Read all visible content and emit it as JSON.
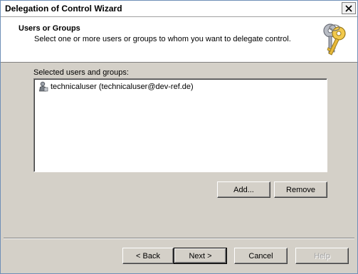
{
  "window": {
    "title": "Delegation of Control Wizard",
    "close_glyph": "✕"
  },
  "header": {
    "title": "Users or Groups",
    "subtitle": "Select one or more users or groups to whom you want to delegate control.",
    "icon": "keys-icon"
  },
  "selection": {
    "label": "Selected users and groups:",
    "items": [
      {
        "icon": "user-icon",
        "text": "technicaluser (technicaluser@dev-ref.de)"
      }
    ]
  },
  "buttons": {
    "add": "Add...",
    "remove": "Remove",
    "back": "< Back",
    "next": "Next >",
    "cancel": "Cancel",
    "help": "Help"
  },
  "colors": {
    "dialog_bg": "#d4d0c8",
    "header_bg": "#ffffff",
    "disabled_text": "#a0a0a0"
  }
}
